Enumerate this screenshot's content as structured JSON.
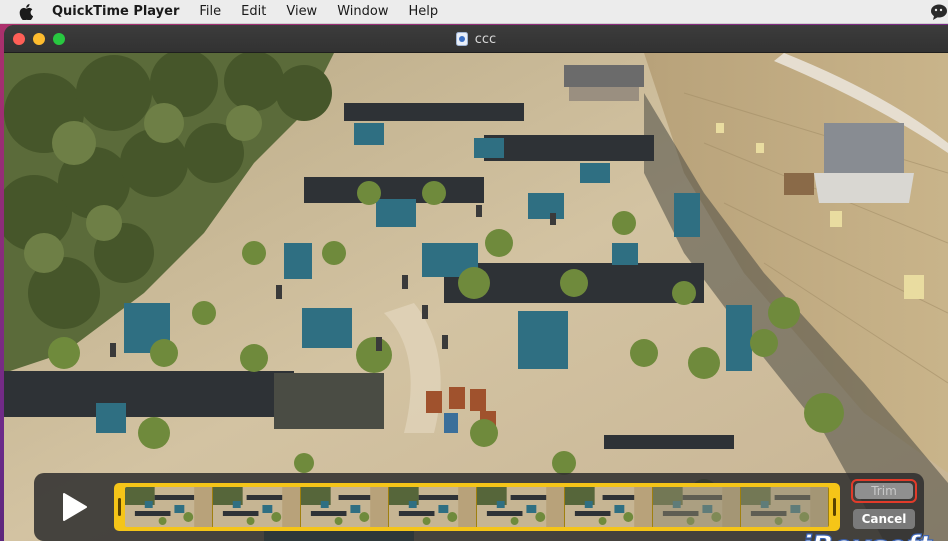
{
  "menubar": {
    "app_name": "QuickTime Player",
    "items": [
      "File",
      "Edit",
      "View",
      "Window",
      "Help"
    ]
  },
  "window": {
    "title": "ccc"
  },
  "trim_bar": {
    "trim_label": "Trim",
    "cancel_label": "Cancel",
    "frame_count": 8
  },
  "watermark": {
    "text": "iBoysoft"
  },
  "colors": {
    "trim_strip": "#f5c518",
    "trim_highlight": "#e23b2a",
    "close": "#ff5f57",
    "minimize": "#febc2e",
    "zoom": "#28c840"
  }
}
